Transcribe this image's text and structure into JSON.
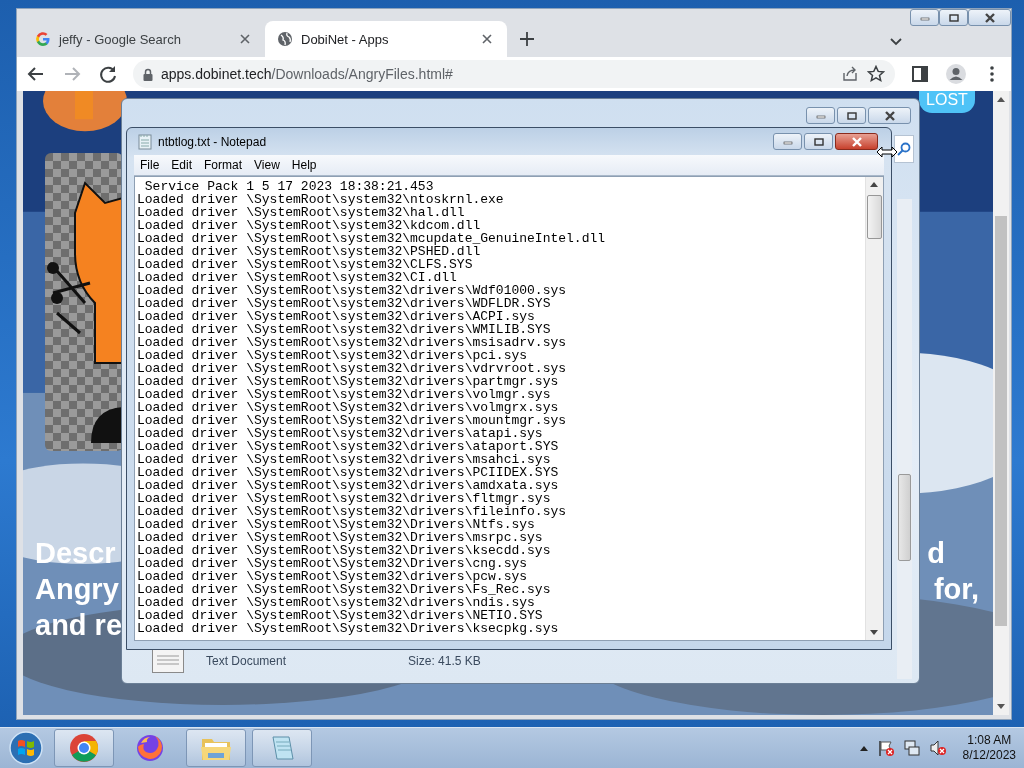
{
  "browser": {
    "tabs": [
      {
        "title": "jeffy - Google Search",
        "kind": "google",
        "selected": false
      },
      {
        "title": "DobiNet - Apps",
        "kind": "globe",
        "selected": true
      }
    ],
    "url_host": "apps.dobinet.tech",
    "url_path": "/Downloads/AngryFiles.html#"
  },
  "page": {
    "badge": "LOST",
    "heading_left": [
      "Descr",
      "Angry",
      "and re"
    ],
    "heading_right": [
      "d",
      "for,"
    ]
  },
  "explorer": {
    "file_type": "Text Document",
    "file_size": "Size: 41.5 KB"
  },
  "notepad": {
    "title": "ntbtlog.txt - Notepad",
    "menu": [
      "File",
      "Edit",
      "Format",
      "View",
      "Help"
    ],
    "lines": [
      " Service Pack 1 5 17 2023 18:38:21.453",
      "Loaded driver \\SystemRoot\\system32\\ntoskrnl.exe",
      "Loaded driver \\SystemRoot\\system32\\hal.dll",
      "Loaded driver \\SystemRoot\\system32\\kdcom.dll",
      "Loaded driver \\SystemRoot\\system32\\mcupdate_GenuineIntel.dll",
      "Loaded driver \\SystemRoot\\system32\\PSHED.dll",
      "Loaded driver \\SystemRoot\\system32\\CLFS.SYS",
      "Loaded driver \\SystemRoot\\system32\\CI.dll",
      "Loaded driver \\SystemRoot\\system32\\drivers\\Wdf01000.sys",
      "Loaded driver \\SystemRoot\\system32\\drivers\\WDFLDR.SYS",
      "Loaded driver \\SystemRoot\\system32\\drivers\\ACPI.sys",
      "Loaded driver \\SystemRoot\\system32\\drivers\\WMILIB.SYS",
      "Loaded driver \\SystemRoot\\system32\\drivers\\msisadrv.sys",
      "Loaded driver \\SystemRoot\\system32\\drivers\\pci.sys",
      "Loaded driver \\SystemRoot\\system32\\drivers\\vdrvroot.sys",
      "Loaded driver \\SystemRoot\\System32\\drivers\\partmgr.sys",
      "Loaded driver \\SystemRoot\\system32\\drivers\\volmgr.sys",
      "Loaded driver \\SystemRoot\\System32\\drivers\\volmgrx.sys",
      "Loaded driver \\SystemRoot\\System32\\drivers\\mountmgr.sys",
      "Loaded driver \\SystemRoot\\system32\\drivers\\atapi.sys",
      "Loaded driver \\SystemRoot\\system32\\drivers\\ataport.SYS",
      "Loaded driver \\SystemRoot\\system32\\drivers\\msahci.sys",
      "Loaded driver \\SystemRoot\\system32\\drivers\\PCIIDEX.SYS",
      "Loaded driver \\SystemRoot\\system32\\drivers\\amdxata.sys",
      "Loaded driver \\SystemRoot\\system32\\drivers\\fltmgr.sys",
      "Loaded driver \\SystemRoot\\system32\\drivers\\fileinfo.sys",
      "Loaded driver \\SystemRoot\\System32\\Drivers\\Ntfs.sys",
      "Loaded driver \\SystemRoot\\System32\\Drivers\\msrpc.sys",
      "Loaded driver \\SystemRoot\\System32\\Drivers\\ksecdd.sys",
      "Loaded driver \\SystemRoot\\System32\\Drivers\\cng.sys",
      "Loaded driver \\SystemRoot\\System32\\drivers\\pcw.sys",
      "Loaded driver \\SystemRoot\\System32\\Drivers\\Fs_Rec.sys",
      "Loaded driver \\SystemRoot\\system32\\drivers\\ndis.sys",
      "Loaded driver \\SystemRoot\\System32\\drivers\\NETIO.SYS",
      "Loaded driver \\SystemRoot\\System32\\Drivers\\ksecpkg.sys"
    ]
  },
  "taskbar": {
    "apps": [
      {
        "kind": "chrome",
        "running": true
      },
      {
        "kind": "firefox",
        "running": false
      },
      {
        "kind": "explorer",
        "running": true
      },
      {
        "kind": "notepad",
        "running": true
      }
    ],
    "time": "1:08 AM",
    "date": "8/12/2023"
  }
}
